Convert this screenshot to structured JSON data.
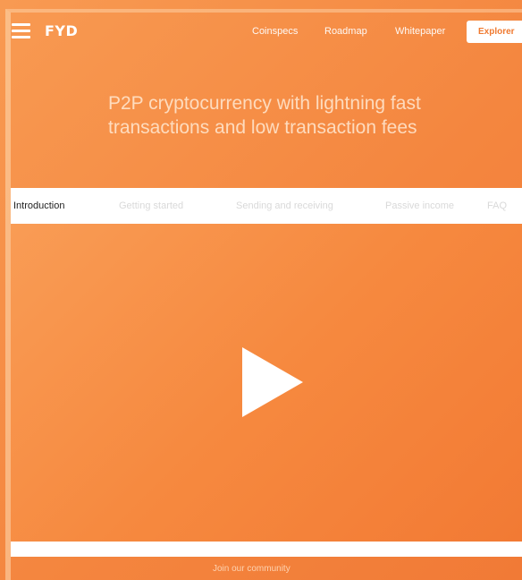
{
  "header": {
    "logo": "FYD",
    "nav": [
      "Coinspecs",
      "Roadmap",
      "Whitepaper"
    ],
    "explorer_button": "Explorer",
    "menu_icon": "hamburger-menu-icon"
  },
  "hero": {
    "title": "P2P cryptocurrency with lightning fast transactions and low transaction fees"
  },
  "tabs": [
    "Introduction",
    "Getting started",
    "Sending and receiving",
    "Passive income",
    "FAQ"
  ],
  "active_tab": "Introduction",
  "video": {
    "play_icon": "play-icon"
  },
  "footer": {
    "community": "Join our community"
  },
  "colors": {
    "accent": "#f4863f",
    "button_text": "#f07a30"
  }
}
